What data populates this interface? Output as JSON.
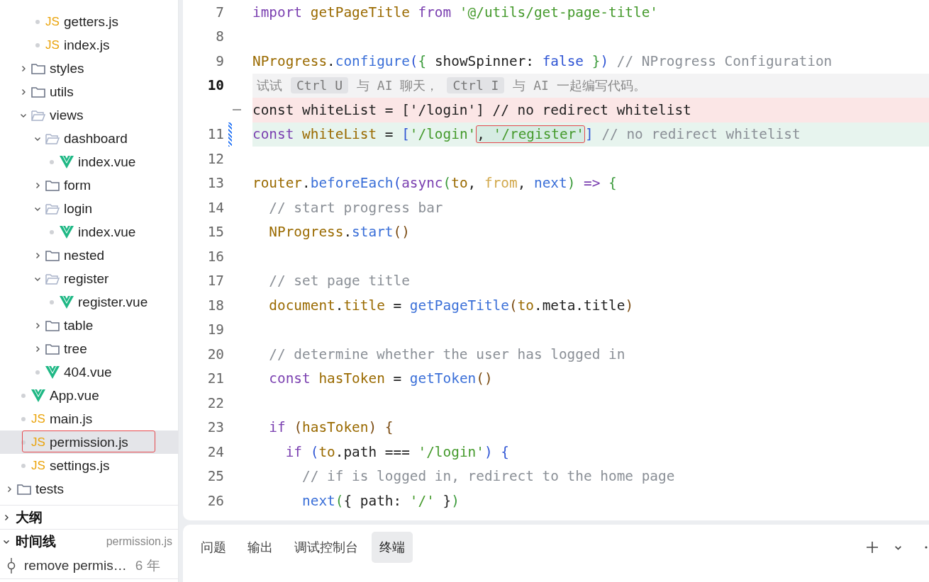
{
  "explorer": {
    "tree": [
      {
        "children": [
          {
            "children": [
              {
                "name": "getters.js",
                "kind": "js",
                "badge": "JS",
                "selected": false,
                "annotated": false
              },
              {
                "name": "index.js",
                "kind": "js",
                "badge": "JS",
                "selected": false,
                "annotated": false
              }
            ]
          },
          {
            "name": "styles",
            "kind": "folder",
            "expanded": false,
            "selected": false,
            "annotated": false
          },
          {
            "name": "utils",
            "kind": "folder",
            "expanded": false,
            "selected": false,
            "annotated": false
          },
          {
            "name": "views",
            "kind": "folder",
            "expanded": true,
            "selected": false,
            "annotated": false,
            "children": [
              {
                "name": "dashboard",
                "kind": "folder",
                "expanded": true,
                "selected": false,
                "annotated": false,
                "children": [
                  {
                    "name": "index.vue",
                    "kind": "vue",
                    "selected": false,
                    "annotated": false
                  }
                ]
              },
              {
                "name": "form",
                "kind": "folder",
                "expanded": false,
                "selected": false,
                "annotated": false
              },
              {
                "name": "login",
                "kind": "folder",
                "expanded": true,
                "selected": false,
                "annotated": false,
                "children": [
                  {
                    "name": "index.vue",
                    "kind": "vue",
                    "selected": false,
                    "annotated": false
                  }
                ]
              },
              {
                "name": "nested",
                "kind": "folder",
                "expanded": false,
                "selected": false,
                "annotated": false
              },
              {
                "name": "register",
                "kind": "folder",
                "expanded": true,
                "selected": false,
                "annotated": false,
                "children": [
                  {
                    "name": "register.vue",
                    "kind": "vue",
                    "selected": false,
                    "annotated": false
                  }
                ]
              },
              {
                "name": "table",
                "kind": "folder",
                "expanded": false,
                "selected": false,
                "annotated": false
              },
              {
                "name": "tree",
                "kind": "folder",
                "expanded": false,
                "selected": false,
                "annotated": false
              },
              {
                "name": "404.vue",
                "kind": "vue",
                "selected": false,
                "annotated": false
              }
            ]
          },
          {
            "name": "App.vue",
            "kind": "vue",
            "selected": false,
            "annotated": false
          },
          {
            "name": "main.js",
            "kind": "js",
            "badge": "JS",
            "selected": false,
            "annotated": false
          },
          {
            "name": "permission.js",
            "kind": "js",
            "badge": "JS",
            "selected": true,
            "annotated": true
          },
          {
            "name": "settings.js",
            "kind": "js",
            "badge": "JS",
            "selected": false,
            "annotated": false
          }
        ]
      },
      {
        "name": "tests",
        "kind": "folder",
        "expanded": false,
        "selected": false,
        "annotated": false
      }
    ]
  },
  "sections": [
    {
      "title": "大纲",
      "expanded": false
    },
    {
      "title": "时间线",
      "expanded": true,
      "subtitle": "permission.js",
      "entries": [
        {
          "message": "remove permis…",
          "age": "6 年"
        }
      ]
    }
  ],
  "editor": {
    "lines": [
      {
        "kind": "code",
        "number": "7",
        "current": false,
        "tokens": [
          {
            "t": "import",
            "kind": "kw"
          },
          {
            "t": " getPageTitle",
            "kind": "var"
          },
          {
            "t": " from",
            "kind": "kw"
          },
          {
            "t": " '@/utils/get-page-title'",
            "kind": "str"
          }
        ]
      },
      {
        "kind": "code",
        "number": "8",
        "current": false
      },
      {
        "kind": "code",
        "number": "9",
        "current": false,
        "tokens": [
          {
            "t": "NProgress",
            "kind": "var"
          },
          {
            "t": "."
          },
          {
            "t": "configure",
            "kind": "fn"
          },
          {
            "t": "(",
            "kind": "br1"
          },
          {
            "t": "{",
            "kind": "br2"
          },
          {
            "t": " showSpinner: "
          },
          {
            "t": "false",
            "kind": "lit"
          },
          {
            "t": " }",
            "kind": "br2"
          },
          {
            "t": ")",
            "kind": "br1"
          },
          {
            "t": " // NProgress Configuration",
            "kind": "cmt"
          }
        ]
      },
      {
        "kind": "hint",
        "number": "10",
        "current": true,
        "parts": [
          {
            "t": "试试",
            "key": false
          },
          {
            "t": "Ctrl U",
            "key": true
          },
          {
            "t": "与 AI 聊天，",
            "key": false
          },
          {
            "t": "Ctrl I",
            "key": true
          },
          {
            "t": "与 AI 一起编写代码。",
            "key": false
          }
        ]
      },
      {
        "kind": "deleted",
        "tokens": [
          {
            "t": "const whiteList = ['/login'] // no redirect whitelist"
          }
        ]
      },
      {
        "kind": "added",
        "number": "11",
        "current": false,
        "tokens": [
          {
            "t": "const",
            "kind": "kw"
          },
          {
            "t": " whiteList",
            "kind": "var"
          },
          {
            "t": " = "
          },
          {
            "t": "[",
            "kind": "br1"
          },
          {
            "t": "'/login'",
            "kind": "str"
          },
          {
            "t": ", ",
            "annotated": true
          },
          {
            "t": "'/register'",
            "kind": "str",
            "annotated": true
          },
          {
            "t": "]",
            "kind": "br1"
          },
          {
            "t": " // no redirect whitelist",
            "kind": "cmt"
          }
        ]
      },
      {
        "kind": "code",
        "number": "12",
        "current": false
      },
      {
        "kind": "code",
        "number": "13",
        "current": false,
        "tokens": [
          {
            "t": "router",
            "kind": "var"
          },
          {
            "t": "."
          },
          {
            "t": "beforeEach",
            "kind": "fn"
          },
          {
            "t": "(",
            "kind": "br1"
          },
          {
            "t": "async",
            "kind": "kw"
          },
          {
            "t": "(",
            "kind": "br2"
          },
          {
            "t": "to",
            "kind": "var"
          },
          {
            "t": ", "
          },
          {
            "t": "from",
            "kind": "param"
          },
          {
            "t": ", "
          },
          {
            "t": "next",
            "kind": "fn"
          },
          {
            "t": ")",
            "kind": "br2"
          },
          {
            "t": " =>",
            "kind": "kw"
          },
          {
            "t": " {",
            "kind": "br2"
          }
        ]
      },
      {
        "kind": "code",
        "number": "14",
        "current": false,
        "tokens": [
          {
            "t": "  // start progress bar",
            "kind": "cmt"
          }
        ]
      },
      {
        "kind": "code",
        "number": "15",
        "current": false,
        "tokens": [
          {
            "t": "  NProgress",
            "kind": "var"
          },
          {
            "t": "."
          },
          {
            "t": "start",
            "kind": "fn"
          },
          {
            "t": "()",
            "kind": "br3"
          }
        ]
      },
      {
        "kind": "code",
        "number": "16",
        "current": false
      },
      {
        "kind": "code",
        "number": "17",
        "current": false,
        "tokens": [
          {
            "t": "  // set page title",
            "kind": "cmt"
          }
        ]
      },
      {
        "kind": "code",
        "number": "18",
        "current": false,
        "tokens": [
          {
            "t": "  document",
            "kind": "var"
          },
          {
            "t": "."
          },
          {
            "t": "title",
            "kind": "var"
          },
          {
            "t": " = "
          },
          {
            "t": "getPageTitle",
            "kind": "fn"
          },
          {
            "t": "(",
            "kind": "br3"
          },
          {
            "t": "to",
            "kind": "var"
          },
          {
            "t": ".meta.title"
          },
          {
            "t": ")",
            "kind": "br3"
          }
        ]
      },
      {
        "kind": "code",
        "number": "19",
        "current": false
      },
      {
        "kind": "code",
        "number": "20",
        "current": false,
        "tokens": [
          {
            "t": "  // determine whether the user has logged in",
            "kind": "cmt"
          }
        ]
      },
      {
        "kind": "code",
        "number": "21",
        "current": false,
        "tokens": [
          {
            "t": "  const",
            "kind": "kw"
          },
          {
            "t": " hasToken",
            "kind": "var"
          },
          {
            "t": " = "
          },
          {
            "t": "getToken",
            "kind": "fn"
          },
          {
            "t": "()",
            "kind": "br3"
          }
        ]
      },
      {
        "kind": "code",
        "number": "22",
        "current": false
      },
      {
        "kind": "code",
        "number": "23",
        "current": false,
        "tokens": [
          {
            "t": "  if",
            "kind": "kw"
          },
          {
            "t": " (",
            "kind": "br3"
          },
          {
            "t": "hasToken",
            "kind": "var"
          },
          {
            "t": ")",
            "kind": "br3"
          },
          {
            "t": " {",
            "kind": "br3"
          }
        ]
      },
      {
        "kind": "code",
        "number": "24",
        "current": false,
        "tokens": [
          {
            "t": "    if",
            "kind": "kw"
          },
          {
            "t": " (",
            "kind": "br1"
          },
          {
            "t": "to",
            "kind": "var"
          },
          {
            "t": ".path === "
          },
          {
            "t": "'/login'",
            "kind": "str"
          },
          {
            "t": ")",
            "kind": "br1"
          },
          {
            "t": " {",
            "kind": "br1"
          }
        ]
      },
      {
        "kind": "code",
        "number": "25",
        "current": false,
        "tokens": [
          {
            "t": "      // if is logged in, redirect to the home page",
            "kind": "cmt"
          }
        ]
      },
      {
        "kind": "code",
        "number": "26",
        "current": false,
        "tokens": [
          {
            "t": "      next",
            "kind": "fn"
          },
          {
            "t": "(",
            "kind": "br2"
          },
          {
            "t": "{ path: "
          },
          {
            "t": "'/'",
            "kind": "str"
          },
          {
            "t": " }"
          },
          {
            "t": ")",
            "kind": "br2"
          }
        ]
      }
    ]
  },
  "panel": {
    "tabs": [
      {
        "label": "问题",
        "selected": false
      },
      {
        "label": "输出",
        "selected": false
      },
      {
        "label": "调试控制台",
        "selected": false
      },
      {
        "label": "终端",
        "selected": true
      }
    ]
  }
}
